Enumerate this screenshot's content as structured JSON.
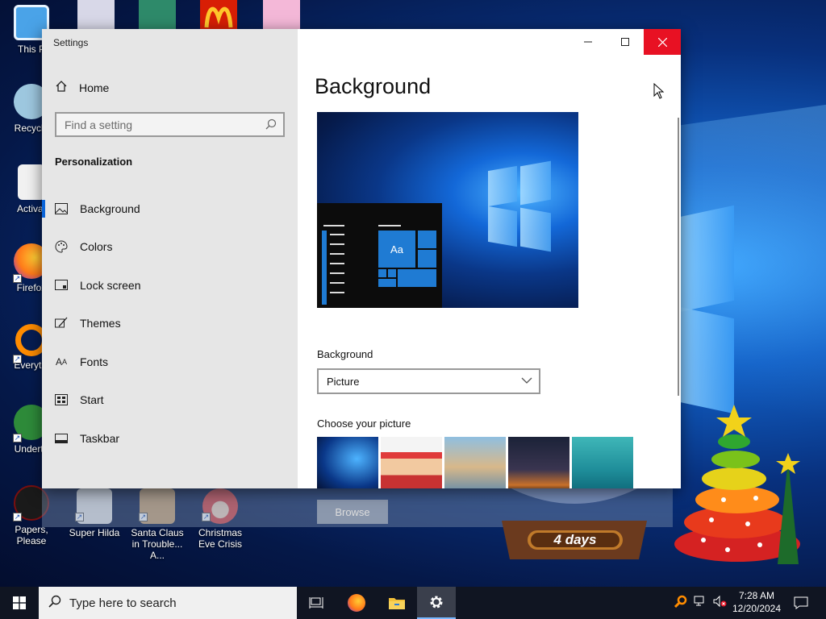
{
  "desktop": {
    "icons": [
      {
        "label": "This P",
        "color": "#4aa3e8"
      },
      {
        "label": "Recycle",
        "color": "#9ec8e0"
      },
      {
        "label": "Activat",
        "color": "#f2f2f2"
      },
      {
        "label": "Firefox",
        "color": "#ff7a1a"
      },
      {
        "label": "Everythi",
        "color": "#ff8c00"
      },
      {
        "label": "Underta",
        "color": "#2e8b3a"
      },
      {
        "label": "Papers, Please",
        "color": "#7a0f0f"
      },
      {
        "label": "Super Hilda",
        "color": "#e8e8e8"
      },
      {
        "label": "Santa Claus in Trouble... A...",
        "color": "#c8a070"
      },
      {
        "label": "Christmas Eve Crisis",
        "color": "#d94040"
      }
    ],
    "gadget_text": "4 days"
  },
  "settings": {
    "window_title": "Settings",
    "home_label": "Home",
    "search_placeholder": "Find a setting",
    "section_title": "Personalization",
    "nav": [
      {
        "label": "Background",
        "icon": "picture-icon",
        "active": true
      },
      {
        "label": "Colors",
        "icon": "palette-icon",
        "active": false
      },
      {
        "label": "Lock screen",
        "icon": "lock-screen-icon",
        "active": false
      },
      {
        "label": "Themes",
        "icon": "brush-icon",
        "active": false
      },
      {
        "label": "Fonts",
        "icon": "fonts-icon",
        "active": false
      },
      {
        "label": "Start",
        "icon": "start-icon",
        "active": false
      },
      {
        "label": "Taskbar",
        "icon": "taskbar-icon",
        "active": false
      }
    ],
    "page_title": "Background",
    "preview_tile_text": "Aa",
    "background_label": "Background",
    "background_value": "Picture",
    "choose_picture_label": "Choose your picture",
    "browse_label": "Browse",
    "accent_color": "#0a64d8"
  },
  "taskbar": {
    "search_placeholder": "Type here to search",
    "time": "7:28 AM",
    "date": "12/20/2024"
  }
}
